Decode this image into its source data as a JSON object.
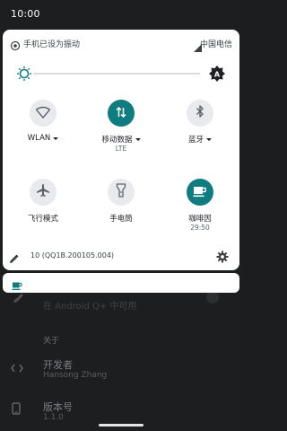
{
  "status_bar": {
    "time": "10:00"
  },
  "shade": {
    "header": {
      "ringer_text": "手机已设为振动",
      "carrier": "中国电信"
    },
    "brightness": {
      "level_fraction": 0.0
    },
    "tiles": [
      {
        "label": "WLAN",
        "sub": "",
        "active": false,
        "icon": "wifi-icon",
        "has_caret": true
      },
      {
        "label": "移动数据",
        "sub": "LTE",
        "active": true,
        "icon": "mobile-data-icon",
        "has_caret": true
      },
      {
        "label": "蓝牙",
        "sub": "",
        "active": false,
        "icon": "bluetooth-icon",
        "has_caret": true
      },
      {
        "label": "飞行模式",
        "sub": "",
        "active": false,
        "icon": "airplane-icon",
        "has_caret": false
      },
      {
        "label": "手电筒",
        "sub": "",
        "active": false,
        "icon": "flashlight-icon",
        "has_caret": false
      },
      {
        "label": "咖啡因",
        "sub": "29:50",
        "active": true,
        "icon": "coffee-icon",
        "has_caret": false
      }
    ],
    "footer": {
      "build": "10 (QQ1B.200105.004)"
    }
  },
  "background_app": {
    "row_partial": "在 Android Q+ 中可用",
    "section": "关于",
    "developer": {
      "title": "开发者",
      "subtitle": "Hansong Zhang"
    },
    "version": {
      "title": "版本号",
      "subtitle": "1.1.0"
    }
  },
  "colors": {
    "accent": "#0f7c80",
    "shade_bg": "#ffffff",
    "screen_bg": "#1d1e20"
  }
}
